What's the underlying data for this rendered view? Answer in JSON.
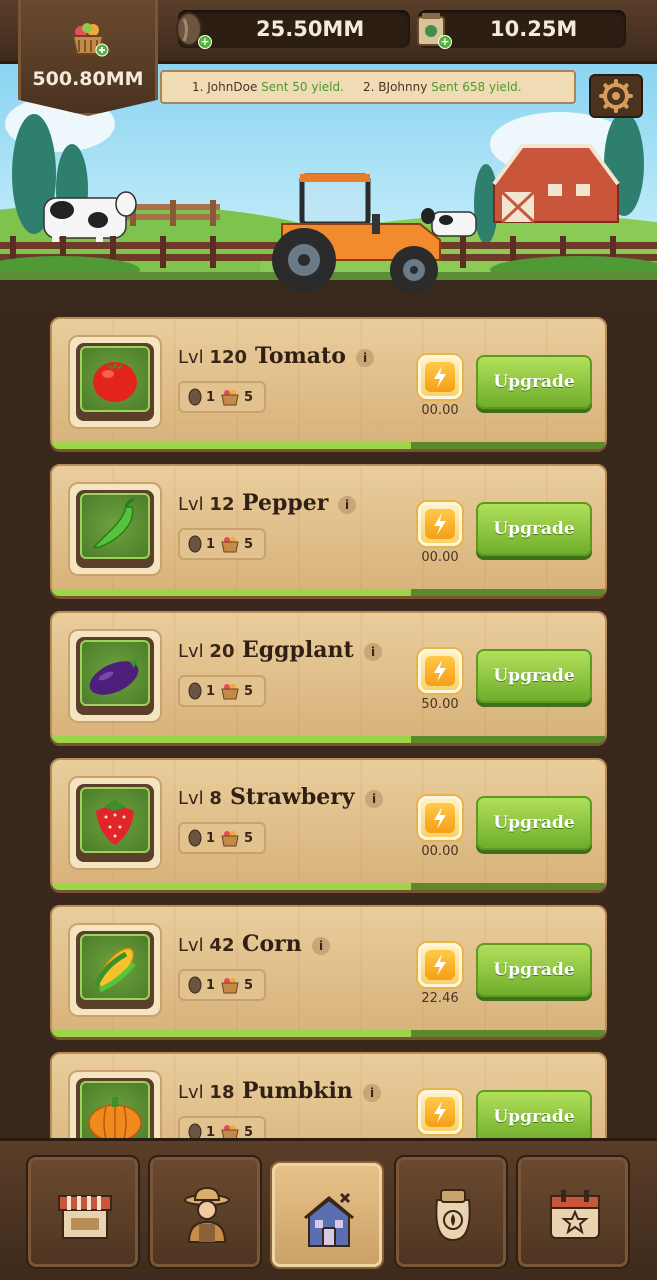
{
  "header": {
    "seeds_value": "25.50MM",
    "bags_value": "10.25M",
    "basket_value": "500.80MM"
  },
  "ticker": {
    "item1_name": "1. JohnDoe",
    "item1_text": "Sent 50 yield.",
    "item2_name": "2. BJohnny",
    "item2_text": "Sent 658 yield."
  },
  "crops": [
    {
      "lvl_label": "Lvl",
      "level": "120",
      "name": "Tomato",
      "info": "i",
      "seed_cost": "1",
      "basket_cost": "5",
      "boost_value": "00.00",
      "upgrade_label": "Upgrade",
      "progress": 0.65
    },
    {
      "lvl_label": "Lvl",
      "level": "12",
      "name": "Pepper",
      "info": "i",
      "seed_cost": "1",
      "basket_cost": "5",
      "boost_value": "00.00",
      "upgrade_label": "Upgrade",
      "progress": 0.65
    },
    {
      "lvl_label": "Lvl",
      "level": "20",
      "name": "Eggplant",
      "info": "i",
      "seed_cost": "1",
      "basket_cost": "5",
      "boost_value": "50.00",
      "upgrade_label": "Upgrade",
      "progress": 0.65
    },
    {
      "lvl_label": "Lvl",
      "level": "8",
      "name": "Strawbery",
      "info": "i",
      "seed_cost": "1",
      "basket_cost": "5",
      "boost_value": "00.00",
      "upgrade_label": "Upgrade",
      "progress": 0.65
    },
    {
      "lvl_label": "Lvl",
      "level": "42",
      "name": "Corn",
      "info": "i",
      "seed_cost": "1",
      "basket_cost": "5",
      "boost_value": "22.46",
      "upgrade_label": "Upgrade",
      "progress": 0.65
    },
    {
      "lvl_label": "Lvl",
      "level": "18",
      "name": "Pumbkin",
      "info": "i",
      "seed_cost": "1",
      "basket_cost": "5",
      "boost_value": "",
      "upgrade_label": "Upgrade",
      "progress": 0.65
    }
  ],
  "nav": {
    "items": [
      "market-stall-icon",
      "farmer-icon",
      "farmhouse-icon",
      "seed-bag-icon",
      "calendar-star-icon"
    ],
    "active": 2
  },
  "colors": {
    "upgrade_green": "#7dbb35",
    "boost_orange": "#f7b52a",
    "wood_light": "#e3c48f",
    "wood_dark": "#3b2a1f"
  }
}
